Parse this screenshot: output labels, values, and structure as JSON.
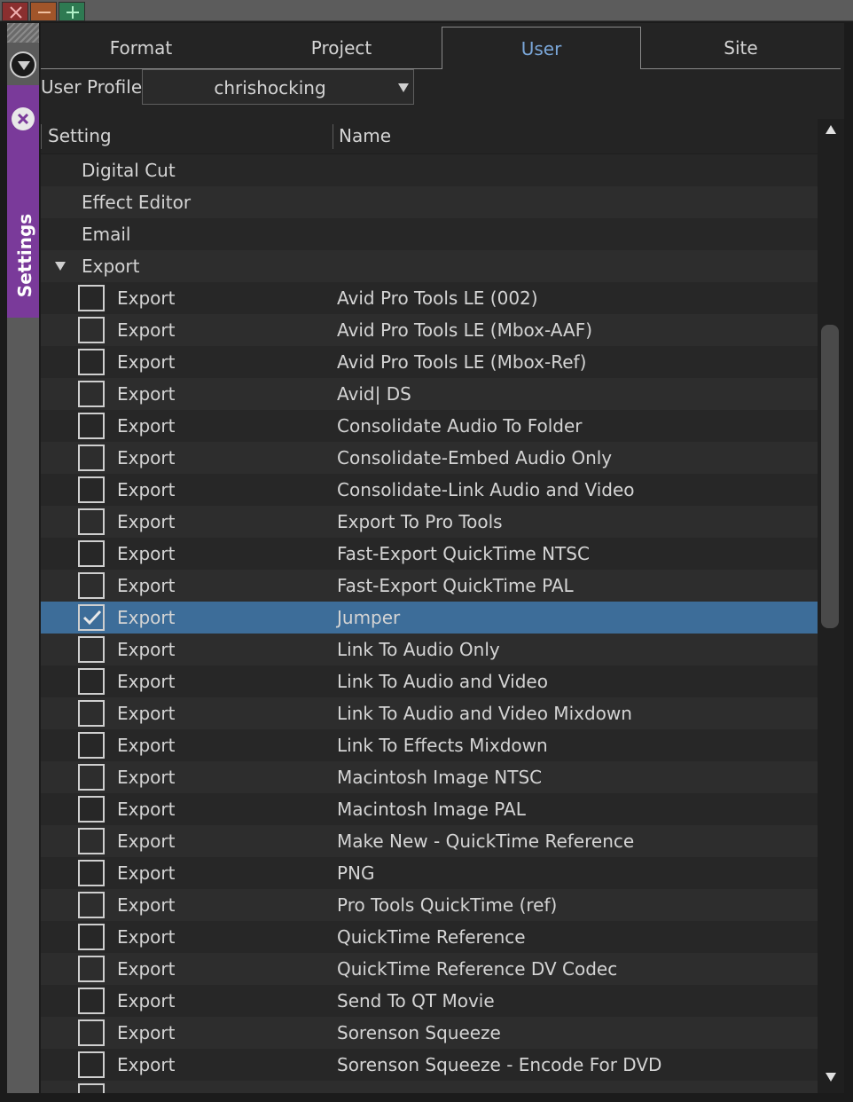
{
  "window": {
    "close_icon": "x-icon",
    "minimize_icon": "minus-icon",
    "maximize_icon": "plus-icon"
  },
  "sidebar": {
    "tab_label": "Settings",
    "tab_color": "#7a3a9a"
  },
  "tabs": [
    {
      "label": "Format",
      "active": false
    },
    {
      "label": "Project",
      "active": false
    },
    {
      "label": "User",
      "active": true
    },
    {
      "label": "Site",
      "active": false
    }
  ],
  "profile": {
    "label": "User Profile:",
    "value": "chrishocking"
  },
  "list": {
    "columns": [
      "Setting",
      "Name"
    ],
    "groups": [
      "Digital Cut",
      "Effect Editor",
      "Email"
    ],
    "expanded_group": "Export",
    "rows": [
      {
        "setting": "Export",
        "name": "Avid Pro Tools LE (002)",
        "checked": false
      },
      {
        "setting": "Export",
        "name": "Avid Pro Tools LE (Mbox-AAF)",
        "checked": false
      },
      {
        "setting": "Export",
        "name": "Avid Pro Tools LE (Mbox-Ref)",
        "checked": false
      },
      {
        "setting": "Export",
        "name": "Avid| DS",
        "checked": false
      },
      {
        "setting": "Export",
        "name": "Consolidate Audio To Folder",
        "checked": false
      },
      {
        "setting": "Export",
        "name": "Consolidate-Embed Audio Only",
        "checked": false
      },
      {
        "setting": "Export",
        "name": "Consolidate-Link Audio and Video",
        "checked": false
      },
      {
        "setting": "Export",
        "name": "Export To Pro Tools",
        "checked": false
      },
      {
        "setting": "Export",
        "name": "Fast-Export QuickTime NTSC",
        "checked": false
      },
      {
        "setting": "Export",
        "name": "Fast-Export QuickTime PAL",
        "checked": false
      },
      {
        "setting": "Export",
        "name": "Jumper",
        "checked": true
      },
      {
        "setting": "Export",
        "name": "Link To Audio Only",
        "checked": false
      },
      {
        "setting": "Export",
        "name": "Link To Audio and Video",
        "checked": false
      },
      {
        "setting": "Export",
        "name": "Link To Audio and Video Mixdown",
        "checked": false
      },
      {
        "setting": "Export",
        "name": "Link To Effects Mixdown",
        "checked": false
      },
      {
        "setting": "Export",
        "name": "Macintosh Image NTSC",
        "checked": false
      },
      {
        "setting": "Export",
        "name": "Macintosh Image PAL",
        "checked": false
      },
      {
        "setting": "Export",
        "name": "Make New - QuickTime Reference",
        "checked": false
      },
      {
        "setting": "Export",
        "name": "PNG",
        "checked": false
      },
      {
        "setting": "Export",
        "name": "Pro Tools QuickTime (ref)",
        "checked": false
      },
      {
        "setting": "Export",
        "name": "QuickTime Reference",
        "checked": false
      },
      {
        "setting": "Export",
        "name": "QuickTime Reference DV Codec",
        "checked": false
      },
      {
        "setting": "Export",
        "name": "Send To QT Movie",
        "checked": false
      },
      {
        "setting": "Export",
        "name": "Sorenson Squeeze",
        "checked": false
      },
      {
        "setting": "Export",
        "name": "Sorenson Squeeze - Encode For DVD",
        "checked": false
      }
    ],
    "selected_color": "#3d6d99"
  },
  "scrollbar": {
    "up_icon": "triangle-up-icon",
    "down_icon": "triangle-down-icon"
  }
}
